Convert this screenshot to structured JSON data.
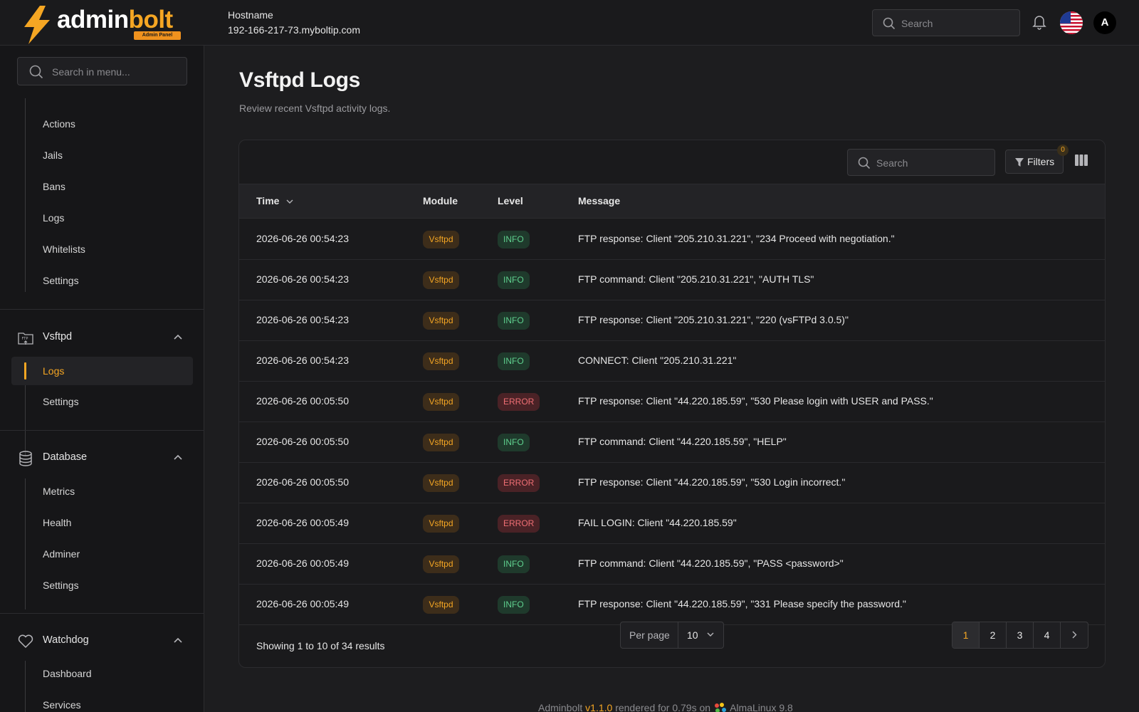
{
  "header": {
    "logo_main": "admin",
    "logo_accent": "bolt",
    "logo_badge": "Admin Panel",
    "hostname_label": "Hostname",
    "hostname_value": "192-166-217-73.myboltip.com",
    "search_placeholder": "Search",
    "avatar_letter": "A"
  },
  "sidebar": {
    "search_placeholder": "Search in menu...",
    "group1_items": [
      {
        "label": "Actions"
      },
      {
        "label": "Jails"
      },
      {
        "label": "Bans"
      },
      {
        "label": "Logs"
      },
      {
        "label": "Whitelists"
      },
      {
        "label": "Settings"
      }
    ],
    "vsftpd": {
      "title": "Vsftpd",
      "items": [
        {
          "label": "Logs",
          "active": true
        },
        {
          "label": "Settings"
        }
      ]
    },
    "database": {
      "title": "Database",
      "items": [
        {
          "label": "Metrics"
        },
        {
          "label": "Health"
        },
        {
          "label": "Adminer"
        },
        {
          "label": "Settings"
        }
      ]
    },
    "watchdog": {
      "title": "Watchdog",
      "items": [
        {
          "label": "Dashboard"
        },
        {
          "label": "Services"
        }
      ]
    }
  },
  "main": {
    "title": "Vsftpd Logs",
    "subtitle": "Review recent Vsftpd activity logs.",
    "table_search_placeholder": "Search",
    "filters_label": "Filters",
    "filters_count": "0",
    "columns": {
      "time": "Time",
      "module": "Module",
      "level": "Level",
      "message": "Message"
    },
    "rows": [
      {
        "time": "2026-06-26 00:54:23",
        "module": "Vsftpd",
        "level": "INFO",
        "message": "FTP response: Client \"205.210.31.221\", \"234 Proceed with negotiation.\""
      },
      {
        "time": "2026-06-26 00:54:23",
        "module": "Vsftpd",
        "level": "INFO",
        "message": "FTP command: Client \"205.210.31.221\", \"AUTH TLS\""
      },
      {
        "time": "2026-06-26 00:54:23",
        "module": "Vsftpd",
        "level": "INFO",
        "message": "FTP response: Client \"205.210.31.221\", \"220 (vsFTPd 3.0.5)\""
      },
      {
        "time": "2026-06-26 00:54:23",
        "module": "Vsftpd",
        "level": "INFO",
        "message": "CONNECT: Client \"205.210.31.221\""
      },
      {
        "time": "2026-06-26 00:05:50",
        "module": "Vsftpd",
        "level": "ERROR",
        "message": "FTP response: Client \"44.220.185.59\", \"530 Please login with USER and PASS.\""
      },
      {
        "time": "2026-06-26 00:05:50",
        "module": "Vsftpd",
        "level": "INFO",
        "message": "FTP command: Client \"44.220.185.59\", \"HELP\""
      },
      {
        "time": "2026-06-26 00:05:50",
        "module": "Vsftpd",
        "level": "ERROR",
        "message": "FTP response: Client \"44.220.185.59\", \"530 Login incorrect.\""
      },
      {
        "time": "2026-06-26 00:05:49",
        "module": "Vsftpd",
        "level": "ERROR",
        "message": "FAIL LOGIN: Client \"44.220.185.59\""
      },
      {
        "time": "2026-06-26 00:05:49",
        "module": "Vsftpd",
        "level": "INFO",
        "message": "FTP command: Client \"44.220.185.59\", \"PASS <password>\""
      },
      {
        "time": "2026-06-26 00:05:49",
        "module": "Vsftpd",
        "level": "INFO",
        "message": "FTP response: Client \"44.220.185.59\", \"331 Please specify the password.\""
      }
    ],
    "showing_text": "Showing 1 to 10 of 34 results",
    "per_page_label": "Per page",
    "per_page_value": "10",
    "pages": [
      "1",
      "2",
      "3",
      "4"
    ],
    "current_page": "1"
  },
  "footer": {
    "prefix": "Adminbolt",
    "version": "v1.1.0",
    "rendered": "rendered for 0.79s on",
    "os": "AlmaLinux 9.8"
  },
  "colors": {
    "accent": "#f5a623",
    "info": "#5fd08e",
    "error": "#ef6f74",
    "background": "#1d1d1f"
  }
}
